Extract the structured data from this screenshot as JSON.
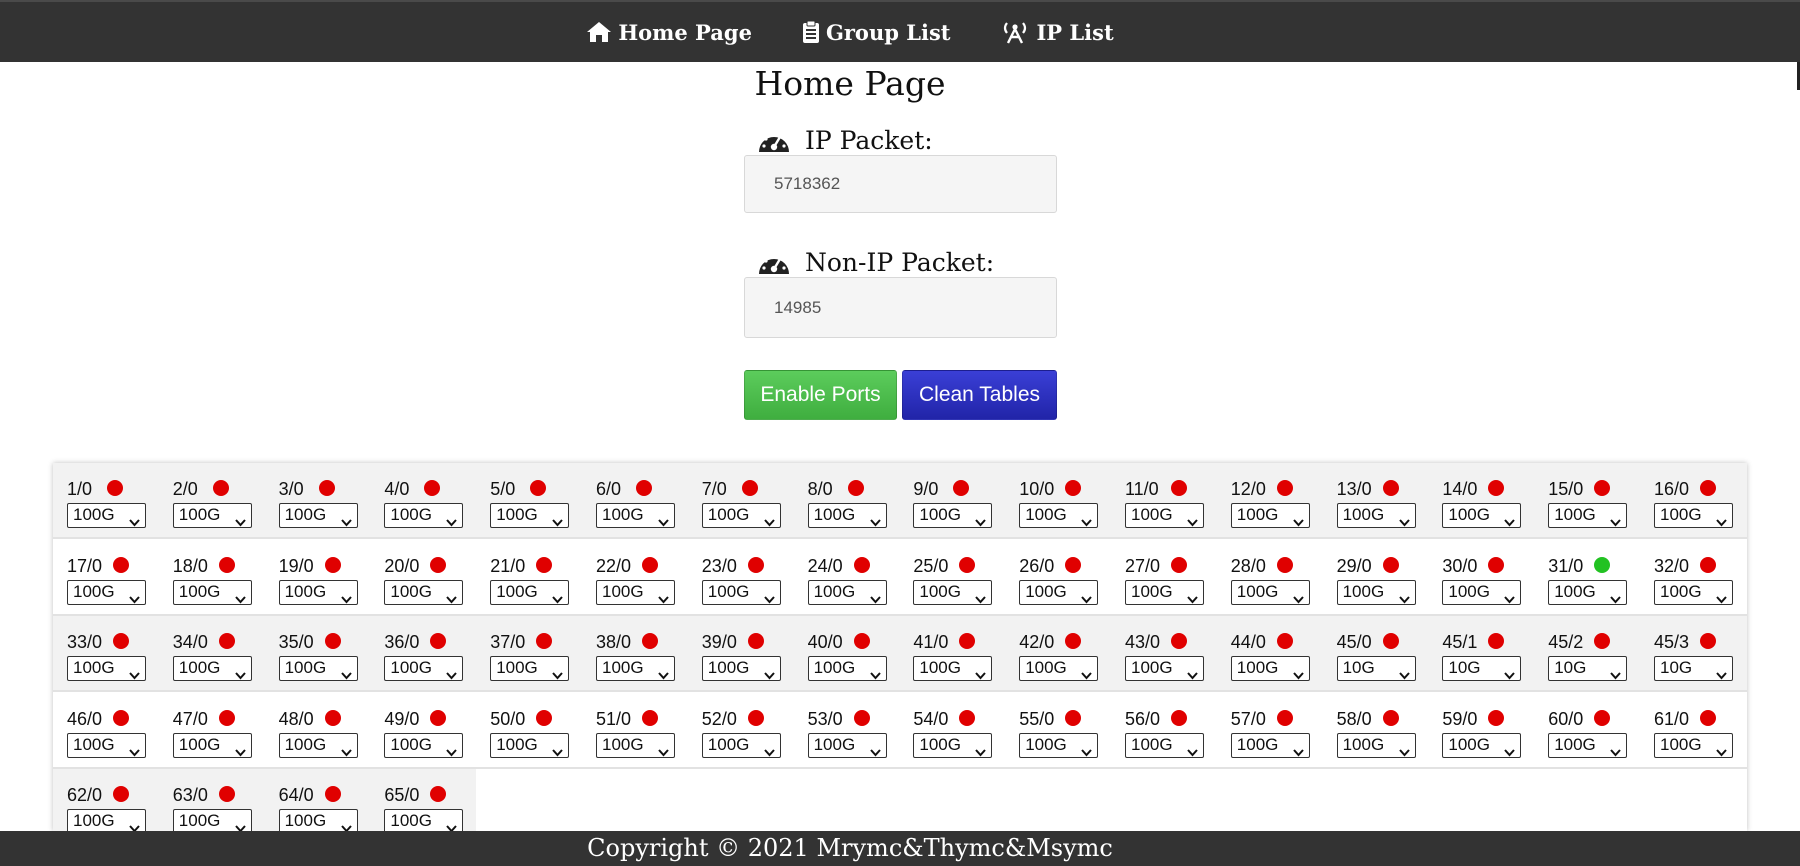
{
  "nav": {
    "items": [
      {
        "label": "Home Page",
        "icon": "home-icon"
      },
      {
        "label": "Group List",
        "icon": "clipboard-icon"
      },
      {
        "label": "IP List",
        "icon": "antenna-icon"
      }
    ]
  },
  "page": {
    "title": "Home Page"
  },
  "stats": {
    "ip_label": "IP Packet:",
    "ip_value": "5718362",
    "nonip_label": "Non-IP Packet:",
    "nonip_value": "14985"
  },
  "buttons": {
    "enable": "Enable Ports",
    "clean": "Clean Tables"
  },
  "colors": {
    "status_down": "#e00000",
    "status_up": "#22c222",
    "enable_btn": "#4cbb4c",
    "clean_btn": "#2a2eb8",
    "nav_bg": "#333333"
  },
  "ports": [
    [
      {
        "id": "1/0",
        "speed": "100G",
        "up": false
      },
      {
        "id": "2/0",
        "speed": "100G",
        "up": false
      },
      {
        "id": "3/0",
        "speed": "100G",
        "up": false
      },
      {
        "id": "4/0",
        "speed": "100G",
        "up": false
      },
      {
        "id": "5/0",
        "speed": "100G",
        "up": false
      },
      {
        "id": "6/0",
        "speed": "100G",
        "up": false
      },
      {
        "id": "7/0",
        "speed": "100G",
        "up": false
      },
      {
        "id": "8/0",
        "speed": "100G",
        "up": false
      },
      {
        "id": "9/0",
        "speed": "100G",
        "up": false
      },
      {
        "id": "10/0",
        "speed": "100G",
        "up": false
      },
      {
        "id": "11/0",
        "speed": "100G",
        "up": false
      },
      {
        "id": "12/0",
        "speed": "100G",
        "up": false
      },
      {
        "id": "13/0",
        "speed": "100G",
        "up": false
      },
      {
        "id": "14/0",
        "speed": "100G",
        "up": false
      },
      {
        "id": "15/0",
        "speed": "100G",
        "up": false
      },
      {
        "id": "16/0",
        "speed": "100G",
        "up": false
      }
    ],
    [
      {
        "id": "17/0",
        "speed": "100G",
        "up": false
      },
      {
        "id": "18/0",
        "speed": "100G",
        "up": false
      },
      {
        "id": "19/0",
        "speed": "100G",
        "up": false
      },
      {
        "id": "20/0",
        "speed": "100G",
        "up": false
      },
      {
        "id": "21/0",
        "speed": "100G",
        "up": false
      },
      {
        "id": "22/0",
        "speed": "100G",
        "up": false
      },
      {
        "id": "23/0",
        "speed": "100G",
        "up": false
      },
      {
        "id": "24/0",
        "speed": "100G",
        "up": false
      },
      {
        "id": "25/0",
        "speed": "100G",
        "up": false
      },
      {
        "id": "26/0",
        "speed": "100G",
        "up": false
      },
      {
        "id": "27/0",
        "speed": "100G",
        "up": false
      },
      {
        "id": "28/0",
        "speed": "100G",
        "up": false
      },
      {
        "id": "29/0",
        "speed": "100G",
        "up": false
      },
      {
        "id": "30/0",
        "speed": "100G",
        "up": false
      },
      {
        "id": "31/0",
        "speed": "100G",
        "up": true
      },
      {
        "id": "32/0",
        "speed": "100G",
        "up": false
      }
    ],
    [
      {
        "id": "33/0",
        "speed": "100G",
        "up": false
      },
      {
        "id": "34/0",
        "speed": "100G",
        "up": false
      },
      {
        "id": "35/0",
        "speed": "100G",
        "up": false
      },
      {
        "id": "36/0",
        "speed": "100G",
        "up": false
      },
      {
        "id": "37/0",
        "speed": "100G",
        "up": false
      },
      {
        "id": "38/0",
        "speed": "100G",
        "up": false
      },
      {
        "id": "39/0",
        "speed": "100G",
        "up": false
      },
      {
        "id": "40/0",
        "speed": "100G",
        "up": false
      },
      {
        "id": "41/0",
        "speed": "100G",
        "up": false
      },
      {
        "id": "42/0",
        "speed": "100G",
        "up": false
      },
      {
        "id": "43/0",
        "speed": "100G",
        "up": false
      },
      {
        "id": "44/0",
        "speed": "100G",
        "up": false
      },
      {
        "id": "45/0",
        "speed": "10G",
        "up": false
      },
      {
        "id": "45/1",
        "speed": "10G",
        "up": false
      },
      {
        "id": "45/2",
        "speed": "10G",
        "up": false
      },
      {
        "id": "45/3",
        "speed": "10G",
        "up": false
      }
    ],
    [
      {
        "id": "46/0",
        "speed": "100G",
        "up": false
      },
      {
        "id": "47/0",
        "speed": "100G",
        "up": false
      },
      {
        "id": "48/0",
        "speed": "100G",
        "up": false
      },
      {
        "id": "49/0",
        "speed": "100G",
        "up": false
      },
      {
        "id": "50/0",
        "speed": "100G",
        "up": false
      },
      {
        "id": "51/0",
        "speed": "100G",
        "up": false
      },
      {
        "id": "52/0",
        "speed": "100G",
        "up": false
      },
      {
        "id": "53/0",
        "speed": "100G",
        "up": false
      },
      {
        "id": "54/0",
        "speed": "100G",
        "up": false
      },
      {
        "id": "55/0",
        "speed": "100G",
        "up": false
      },
      {
        "id": "56/0",
        "speed": "100G",
        "up": false
      },
      {
        "id": "57/0",
        "speed": "100G",
        "up": false
      },
      {
        "id": "58/0",
        "speed": "100G",
        "up": false
      },
      {
        "id": "59/0",
        "speed": "100G",
        "up": false
      },
      {
        "id": "60/0",
        "speed": "100G",
        "up": false
      },
      {
        "id": "61/0",
        "speed": "100G",
        "up": false
      }
    ],
    [
      {
        "id": "62/0",
        "speed": "100G",
        "up": false
      },
      {
        "id": "63/0",
        "speed": "100G",
        "up": false
      },
      {
        "id": "64/0",
        "speed": "100G",
        "up": false
      },
      {
        "id": "65/0",
        "speed": "100G",
        "up": false
      }
    ]
  ],
  "footer": {
    "text": "Copyright © 2021 Mrymc&Thymc&Msymc"
  }
}
